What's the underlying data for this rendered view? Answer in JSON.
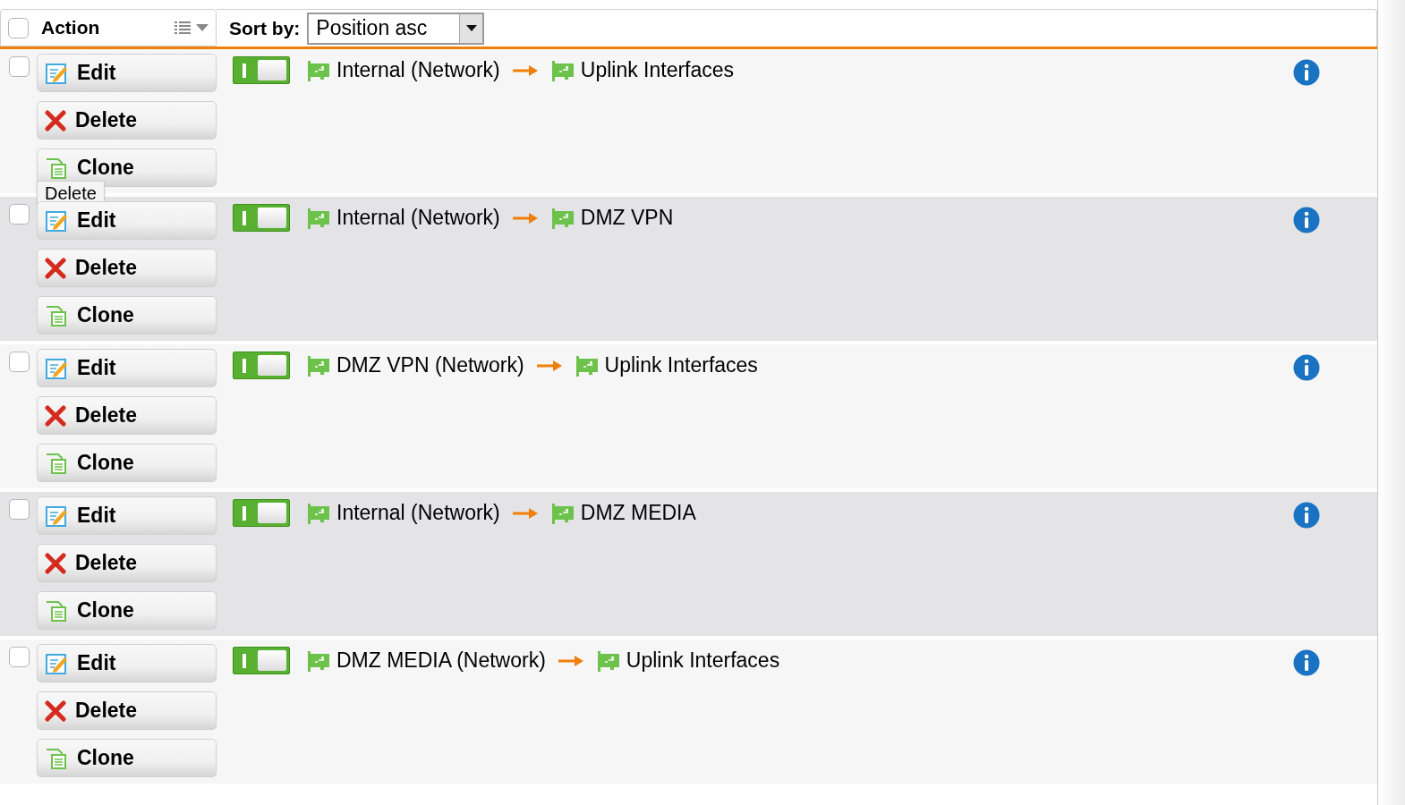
{
  "header": {
    "select_all_checked": false,
    "action_label": "Action",
    "sort_label": "Sort by:",
    "sort_value": "Position asc"
  },
  "rows": [
    {
      "checked": false,
      "enabled": true,
      "source": "Internal (Network)",
      "target": "Uplink Interfaces",
      "buttons": [
        {
          "kind": "edit",
          "label": "Edit"
        },
        {
          "kind": "delete",
          "label": "Delete"
        },
        {
          "kind": "clone",
          "label": "Clone"
        }
      ],
      "tooltip": "Delete"
    },
    {
      "checked": false,
      "enabled": true,
      "source": "Internal (Network)",
      "target": "DMZ VPN",
      "buttons": [
        {
          "kind": "edit",
          "label": "Edit"
        },
        {
          "kind": "delete",
          "label": "Delete"
        },
        {
          "kind": "clone",
          "label": "Clone"
        }
      ]
    },
    {
      "checked": false,
      "enabled": true,
      "source": "DMZ VPN (Network)",
      "target": "Uplink Interfaces",
      "buttons": [
        {
          "kind": "edit",
          "label": "Edit"
        },
        {
          "kind": "delete",
          "label": "Delete"
        },
        {
          "kind": "clone",
          "label": "Clone"
        }
      ]
    },
    {
      "checked": false,
      "enabled": true,
      "source": "Internal (Network)",
      "target": "DMZ MEDIA",
      "buttons": [
        {
          "kind": "edit",
          "label": "Edit"
        },
        {
          "kind": "delete",
          "label": "Delete"
        },
        {
          "kind": "clone",
          "label": "Clone"
        }
      ]
    },
    {
      "checked": false,
      "enabled": true,
      "source": "DMZ MEDIA (Network)",
      "target": "Uplink Interfaces",
      "buttons": [
        {
          "kind": "edit",
          "label": "Edit"
        },
        {
          "kind": "delete",
          "label": "Delete"
        },
        {
          "kind": "clone",
          "label": "Clone"
        }
      ]
    }
  ]
}
